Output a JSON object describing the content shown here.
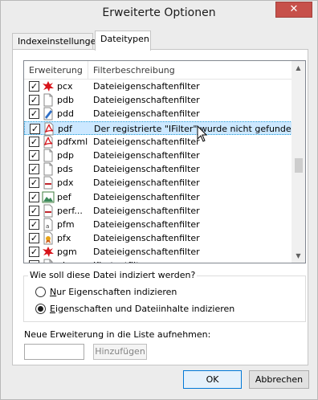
{
  "window": {
    "title": "Erweiterte Optionen",
    "close_glyph": "✕"
  },
  "tabs": [
    {
      "label": "Indexeinstellungen"
    },
    {
      "label": "Dateitypen"
    }
  ],
  "list": {
    "headers": {
      "extension": "Erweiterung",
      "description": "Filterbeschreibung"
    },
    "rows": [
      {
        "ext": "pcx",
        "desc": "Dateieigenschaftenfilter",
        "checked": true,
        "icon": "paint-splat-icon"
      },
      {
        "ext": "pdb",
        "desc": "Dateieigenschaftenfilter",
        "checked": true,
        "icon": "blank-file-icon"
      },
      {
        "ext": "pdd",
        "desc": "Dateieigenschaftenfilter",
        "checked": true,
        "icon": "brush-file-icon"
      },
      {
        "ext": "pdf",
        "desc": "Der registrierte \"IFilter\" wurde nicht gefunden.",
        "checked": true,
        "icon": "pdf-icon",
        "selected": true
      },
      {
        "ext": "pdfxml",
        "desc": "Dateieigenschaftenfilter",
        "checked": true,
        "icon": "pdf-icon"
      },
      {
        "ext": "pdp",
        "desc": "Dateieigenschaftenfilter",
        "checked": true,
        "icon": "blank-file-icon"
      },
      {
        "ext": "pds",
        "desc": "Dateieigenschaftenfilter",
        "checked": true,
        "icon": "blank-file-icon"
      },
      {
        "ext": "pdx",
        "desc": "Dateieigenschaftenfilter",
        "checked": true,
        "icon": "red-bar-file-icon"
      },
      {
        "ext": "pef",
        "desc": "Dateieigenschaftenfilter",
        "checked": true,
        "icon": "image-file-icon"
      },
      {
        "ext": "perf...",
        "desc": "Dateieigenschaftenfilter",
        "checked": true,
        "icon": "red-bar-file-icon"
      },
      {
        "ext": "pfm",
        "desc": "Dateieigenschaftenfilter",
        "checked": true,
        "icon": "font-file-icon"
      },
      {
        "ext": "pfx",
        "desc": "Dateieigenschaftenfilter",
        "checked": true,
        "icon": "certificate-file-icon"
      },
      {
        "ext": "pgm",
        "desc": "Dateieigenschaftenfilter",
        "checked": true,
        "icon": "paint-splat-icon"
      },
      {
        "ext": "php",
        "desc": "Klartextfilter",
        "checked": true,
        "icon": "blank-file-icon"
      }
    ]
  },
  "index_group": {
    "legend": "Wie soll diese Datei indiziert werden?",
    "options": [
      {
        "pre": "N",
        "rest": "ur Eigenschaften indizieren",
        "selected": false
      },
      {
        "pre": "E",
        "rest": "igenschaften und Dateiinhalte indizieren",
        "selected": true
      }
    ]
  },
  "new_extension": {
    "label": "Neue Erweiterung in die Liste aufnehmen:",
    "value": "",
    "add_button": "Hinzufügen"
  },
  "buttons": {
    "ok": "OK",
    "cancel": "Abbrechen"
  }
}
